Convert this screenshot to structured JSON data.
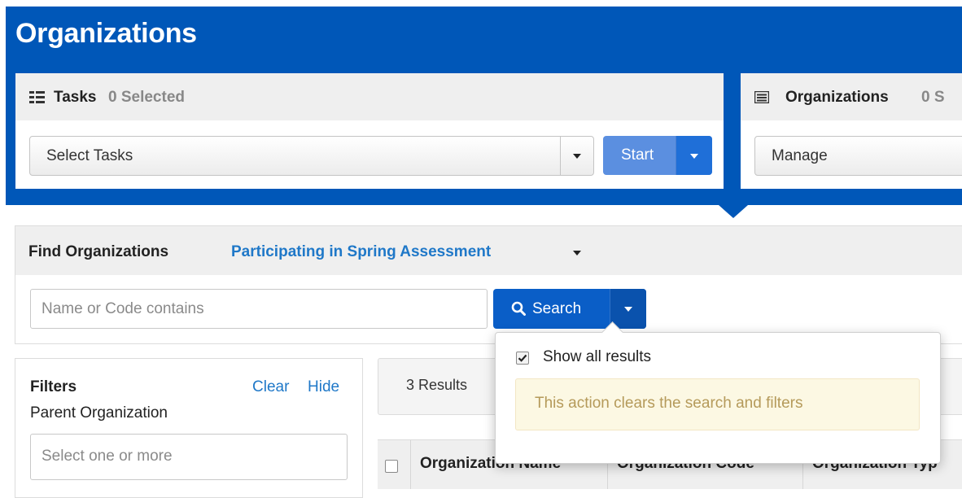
{
  "header": {
    "title": "Organizations"
  },
  "tasks_card": {
    "title": "Tasks",
    "selected_count": "0 Selected",
    "select_value": "Select Tasks",
    "start_label": "Start"
  },
  "orgs_card": {
    "title": "Organizations",
    "selected_count": "0 S",
    "select_value": "Manage"
  },
  "find": {
    "title": "Find Organizations",
    "scope": "Participating in Spring Assessment",
    "search_placeholder": "Name or Code contains",
    "search_label": "Search"
  },
  "search_options": {
    "show_all_label": "Show all results",
    "show_all_checked": true,
    "note": "This action clears the search and filters"
  },
  "filters": {
    "title": "Filters",
    "clear_label": "Clear",
    "hide_label": "Hide",
    "parent_org_label": "Parent Organization",
    "parent_org_placeholder": "Select one or more"
  },
  "results": {
    "count_label": "3 Results"
  },
  "table": {
    "columns": [
      "Organization Name",
      "Organization Code",
      "Organization Typ"
    ]
  },
  "colors": {
    "header_blue": "#0057b8",
    "start_button": "#5b8fe0",
    "search_button": "#0a5ec7",
    "link": "#1f78c8",
    "warning_bg": "#fcf8e3"
  }
}
